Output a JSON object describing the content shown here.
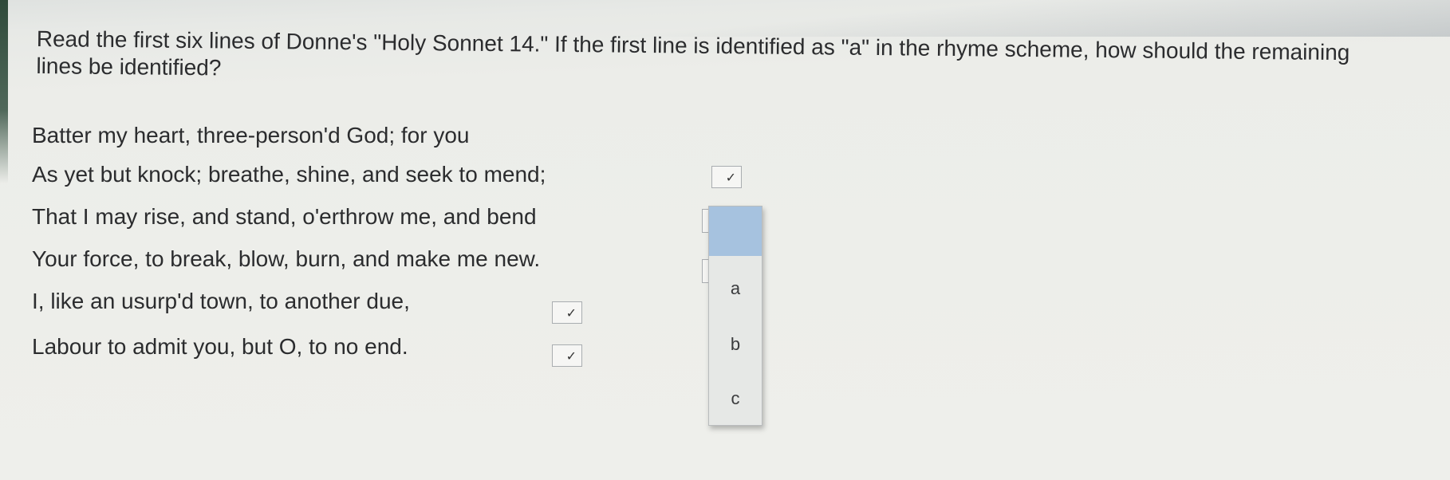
{
  "question": {
    "text": "Read the first six lines of Donne's \"Holy Sonnet 14.\" If the first line is identified as \"a\" in the rhyme scheme, how should the remaining lines be identified?"
  },
  "poem_lines": [
    "Batter my heart, three-person'd God; for you",
    "As yet but knock; breathe, shine, and seek to mend;",
    "That I may rise, and stand, o'erthrow me, and bend",
    "Your force, to break, blow, burn, and make me new.",
    "I, like an usurp'd town, to another due,",
    "Labour to admit you, but O, to no end."
  ],
  "dropdown_options": [
    "",
    "a",
    "b",
    "c"
  ],
  "icons": {
    "select_arrow": "chevron-down-icon"
  },
  "colors": {
    "highlight": "#a6c2df",
    "background": "#eeefeb",
    "text": "#2b2c2e"
  }
}
